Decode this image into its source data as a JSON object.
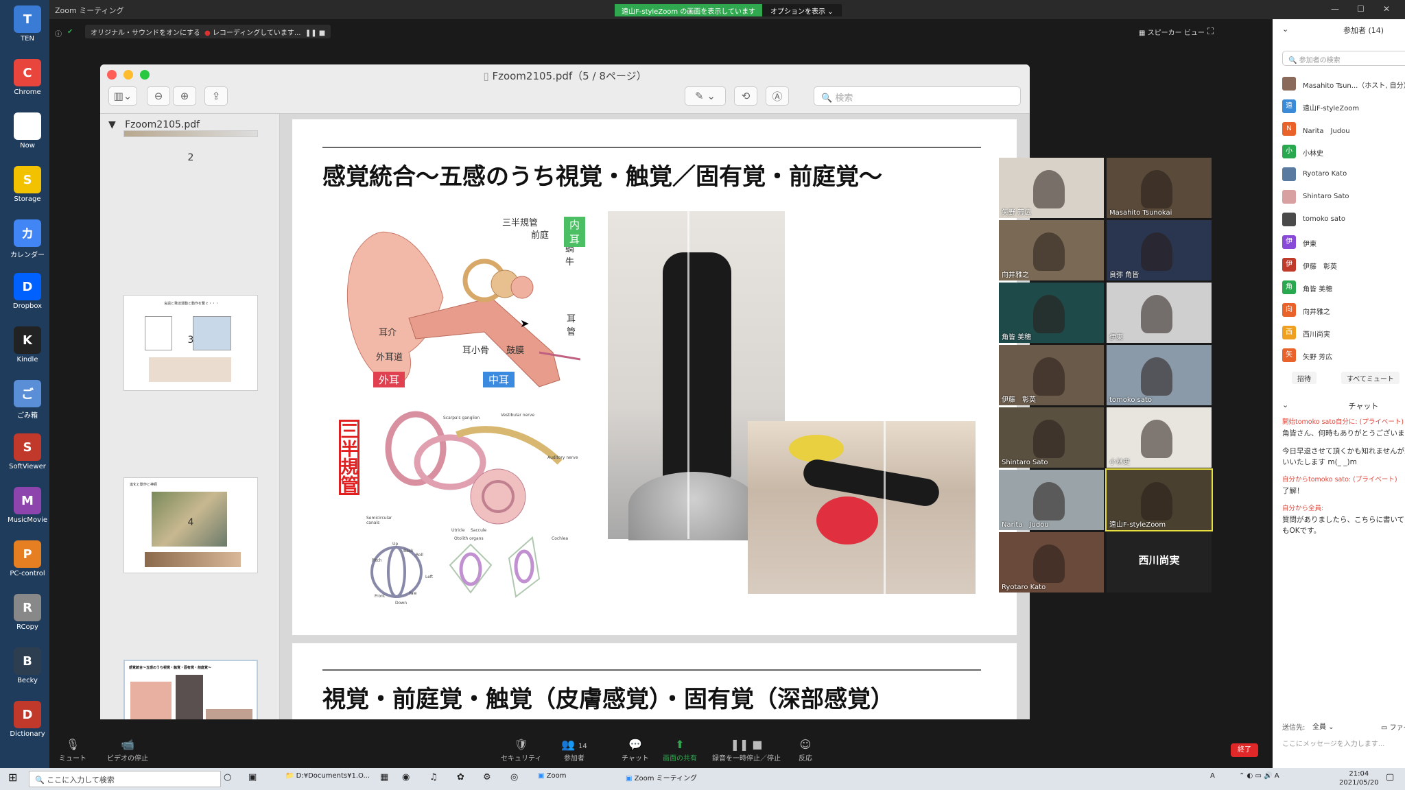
{
  "desktop_icons": [
    {
      "label": "TEN",
      "icon": "computer-icon",
      "color": "#3a7bd5"
    },
    {
      "label": "Chrome",
      "icon": "chrome-icon",
      "color": "#e8453c"
    },
    {
      "label": "Now",
      "icon": "deer-icon",
      "color": "#ffffff"
    },
    {
      "label": "Storage",
      "icon": "sun-icon",
      "color": "#f2c200"
    },
    {
      "label": "カレンダー",
      "icon": "calendar-icon",
      "color": "#4285f4"
    },
    {
      "label": "Dropbox",
      "icon": "dropbox-icon",
      "color": "#0061ff"
    },
    {
      "label": "Kindle",
      "icon": "kindle-icon",
      "color": "#222222"
    },
    {
      "label": "ごみ箱",
      "icon": "trash-icon",
      "color": "#5a8fd8"
    },
    {
      "label": "SoftViewer",
      "icon": "viewer-icon",
      "color": "#c0392b"
    },
    {
      "label": "MusicMovie",
      "icon": "music-icon",
      "color": "#8e44ad"
    },
    {
      "label": "PC-control",
      "icon": "fox-icon",
      "color": "#e67e22"
    },
    {
      "label": "RCopy",
      "icon": "copy-icon",
      "color": "#888888"
    },
    {
      "label": "Becky",
      "icon": "mail-icon",
      "color": "#2c3e50"
    },
    {
      "label": "Dictionary",
      "icon": "book-icon",
      "color": "#c0392b"
    }
  ],
  "zoom_window": {
    "title": "Zoom ミーティング"
  },
  "banner": {
    "sharing": "遠山F-styleZoom の画面を表示しています",
    "options": "オプションを表示 ⌄"
  },
  "toolbar": {
    "original_sound": "オリジナル・サウンドをオンにする",
    "recording": "レコーディングしています...",
    "speaker_view": "スピーカー ビュー"
  },
  "pdf": {
    "title": "Fzoom2105.pdf（5 / 8ページ）",
    "search_placeholder": "検索",
    "sidebar_title": "Fzoom2105.pdf",
    "thumbs": [
      {
        "num": "2"
      },
      {
        "num": "3"
      },
      {
        "num": "4"
      },
      {
        "num": "5"
      }
    ],
    "thumb_texts": [
      "言語と発達運動と動作を繋ぐ・・・",
      "進化と動作と神経",
      "感覚統合〜五感のうち視覚・触覚・固有覚・前庭覚〜"
    ],
    "page5_title": "感覚統合〜五感のうち視覚・触覚／固有覚・前庭覚〜",
    "page6_title": "視覚・前庭覚・触覚（皮膚感覚）・固有覚（深部感覚）",
    "ear_labels": {
      "inner_ear": "内耳",
      "outer_ear": "外耳",
      "middle_ear": "中耳",
      "semicircular": "三半規管",
      "vestibule": "前庭",
      "cochlea": "蝸牛",
      "eustachian": "耳管",
      "pinna": "耳介",
      "canal": "外耳道",
      "ossicles": "耳小骨",
      "eardrum": "鼓膜",
      "vert_label": "三半規管"
    },
    "diagram_small_labels": [
      "Vestibular nerve",
      "Scarpa's ganglion",
      "Auditory nerve",
      "Utricle",
      "Saccule",
      "Otolith organs",
      "Cochlea",
      "Semicircular canals",
      "Up",
      "Back",
      "Roll",
      "Pitch",
      "Yaw",
      "Front",
      "Down",
      "Left"
    ]
  },
  "videos": [
    {
      "name": "矢野 芳広",
      "color": "#d8d2c8"
    },
    {
      "name": "Masahito Tsunokai",
      "color": "#5a4a3a"
    },
    {
      "name": "向井雅之",
      "color": "#7a6a55"
    },
    {
      "name": "良弥 角皆",
      "color": "#2a3550"
    },
    {
      "name": "角皆 美穂",
      "color": "#1f4a4a"
    },
    {
      "name": "伊東",
      "color": "#cfcfcf"
    },
    {
      "name": "伊藤　彰英",
      "color": "#6a5a4a"
    },
    {
      "name": "tomoko sato",
      "color": "#8a9aa8"
    },
    {
      "name": "Shintaro Sato",
      "color": "#5a5040"
    },
    {
      "name": "小林史",
      "color": "#e8e4de"
    },
    {
      "name": "Narita　Judou",
      "color": "#9aa4a8"
    },
    {
      "name": "遠山F-styleZoom",
      "color": "#4a4030"
    },
    {
      "name": "Ryotaro Kato",
      "color": "#6a4a3a"
    },
    {
      "name": "西川尚実",
      "color": "#222222"
    }
  ],
  "panel": {
    "header": "参加者 (14)",
    "search_placeholder": "参加者の検索",
    "participants": [
      {
        "name": "Masahito Tsun...（ホスト, 自分）",
        "initial": "",
        "color": "#8a6a5a",
        "mic": "mic-icon",
        "mic_color": "#888888",
        "cam_color": "#999999"
      },
      {
        "name": "遠山F-styleZoom",
        "initial": "遠",
        "color": "#3a8ad8",
        "mic": "mic-icon",
        "mic_color": "#888888",
        "cam_color": "#999999"
      },
      {
        "name": "Narita　Judou",
        "initial": "N",
        "color": "#e8622a",
        "mic": "mic-icon",
        "mic_color": "#888888",
        "cam_color": "#999999"
      },
      {
        "name": "小林史",
        "initial": "小",
        "color": "#2aa850",
        "mic": "mic-icon",
        "mic_color": "#888888",
        "cam_color": "#999999"
      },
      {
        "name": "Ryotaro Kato",
        "initial": "",
        "color": "#5a7aa0",
        "mic": "mic-muted-icon",
        "mic_color": "#e03030",
        "cam_color": "#e03030"
      },
      {
        "name": "Shintaro Sato",
        "initial": "",
        "color": "#d8a0a0",
        "mic": "mic-muted-icon",
        "mic_color": "#e03030",
        "cam_color": "#999999"
      },
      {
        "name": "tomoko sato",
        "initial": "",
        "color": "#4a4a4a",
        "mic": "mic-muted-icon",
        "mic_color": "#e03030",
        "cam_color": "#999999"
      },
      {
        "name": "伊東",
        "initial": "伊",
        "color": "#8a4ad8",
        "mic": "mic-muted-icon",
        "mic_color": "#e03030",
        "cam_color": "#999999"
      },
      {
        "name": "伊藤　彰英",
        "initial": "伊",
        "color": "#c03a2a",
        "mic": "mic-muted-icon",
        "mic_color": "#e03030",
        "cam_color": "#999999"
      },
      {
        "name": "角皆 美穂",
        "initial": "角",
        "color": "#2aa850",
        "mic": "mic-muted-icon",
        "mic_color": "#e03030",
        "cam_color": "#999999"
      },
      {
        "name": "向井雅之",
        "initial": "向",
        "color": "#e8622a",
        "mic": "mic-muted-icon",
        "mic_color": "#e03030",
        "cam_color": "#999999"
      },
      {
        "name": "西川尚実",
        "initial": "西",
        "color": "#f0a020",
        "mic": "mic-muted-icon",
        "mic_color": "#e03030",
        "cam_color": "#e03030"
      },
      {
        "name": "矢野 芳広",
        "initial": "矢",
        "color": "#e8622a",
        "mic": "mic-muted-icon",
        "mic_color": "#e03030",
        "cam_color": "#999999"
      }
    ],
    "invite": "招待",
    "mute_all": "すべてミュート",
    "more": "...",
    "chat_header": "チャット",
    "chat": [
      {
        "meta": "開始tomoko sato自分に: (プライベート)",
        "text": "角皆さん、何時もありがとうございます"
      },
      {
        "meta": "",
        "text": "今日早退させて頂くかも知れませんが宜しくお願いいたします m(_ _)m"
      },
      {
        "meta": "自分からtomoko sato: (プライベート)",
        "text": "了解！"
      },
      {
        "meta": "自分から全員:",
        "text": "質問がありましたら、こちらに書いていただいてもOKです。"
      }
    ],
    "send_to_label": "送信先:",
    "send_to": "全員 ⌄",
    "file": "ファイル",
    "message_placeholder": "ここにメッセージを入力します..."
  },
  "bottom_bar": {
    "mute": "ミュート",
    "video": "ビデオの停止",
    "security": "セキュリティ",
    "participants": "参加者",
    "participants_count": "14",
    "chat": "チャット",
    "share": "画面の共有",
    "record": "録音を一時停止／停止",
    "reactions": "反応",
    "end": "終了"
  },
  "taskbar": {
    "search": "ここに入力して検索",
    "items": [
      "D:¥Documents¥1.O...",
      "Zoom",
      "Zoom ミーティング"
    ],
    "time": "21:04",
    "date": "2021/05/20"
  }
}
